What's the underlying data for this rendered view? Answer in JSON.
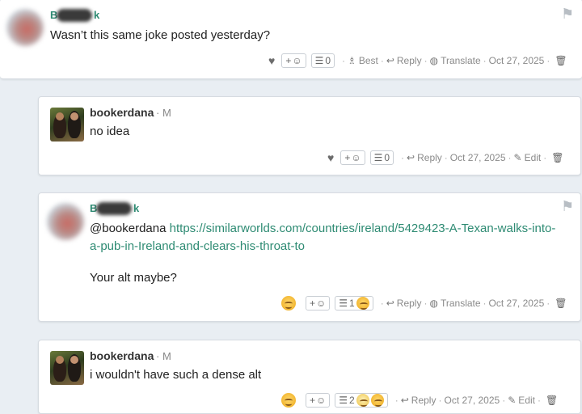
{
  "comments": [
    {
      "username_hint_start": "B",
      "username_hint_end": "k",
      "text": "Wasn’t this same joke posted yesterday?",
      "best_label": "Best",
      "reply_label": "Reply",
      "translate_label": "Translate",
      "date": "Oct 27, 2025",
      "list_count": "0"
    },
    {
      "username": "bookerdana",
      "badge": "M",
      "text": "no idea",
      "reply_label": "Reply",
      "date": "Oct 27, 2025",
      "edit_label": "Edit",
      "list_count": "0"
    },
    {
      "username_hint_start": "B",
      "username_hint_end": "k",
      "mention": "@bookerdana",
      "link_line1": "https://similarworlds.com/countries/ireland/5429423-A-Texan-walks-into-",
      "link_line2": "a-pub-in-Ireland-and-clears-his-throat-to",
      "text2": "Your alt maybe?",
      "reply_label": "Reply",
      "translate_label": "Translate",
      "date": "Oct 27, 2025",
      "list_count": "1"
    },
    {
      "username": "bookerdana",
      "badge": "M",
      "text": "i wouldn't have such a dense alt",
      "reply_label": "Reply",
      "date": "Oct 27, 2025",
      "edit_label": "Edit",
      "list_count": "2"
    }
  ],
  "common": {
    "add_reaction_label": "+",
    "badge_sep": "·"
  },
  "icons": [
    "heart-icon",
    "smiley-icon",
    "list-icon",
    "award-icon",
    "reply-icon",
    "globe-icon",
    "pencil-icon",
    "trash-icon",
    "flag-icon",
    "laughing-emoji-icon",
    "thinking-emoji-icon"
  ]
}
